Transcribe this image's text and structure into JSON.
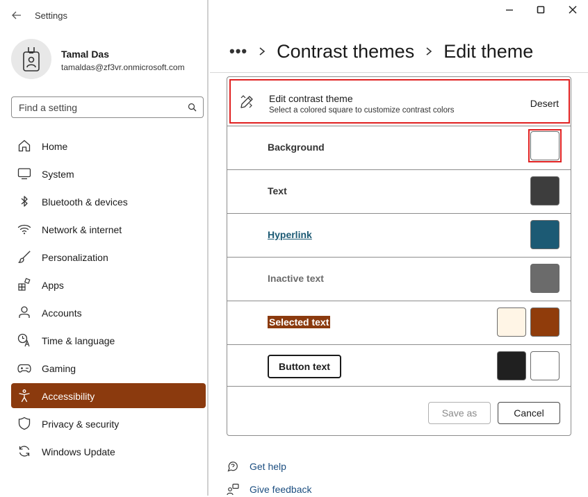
{
  "app": {
    "title": "Settings"
  },
  "user": {
    "name": "Tamal Das",
    "email": "tamaldas@zf3vr.onmicrosoft.com"
  },
  "search": {
    "placeholder": "Find a setting",
    "icon": "search-icon"
  },
  "nav": [
    {
      "id": "home",
      "label": "Home",
      "icon": "home-icon"
    },
    {
      "id": "system",
      "label": "System",
      "icon": "monitor-icon"
    },
    {
      "id": "bluetooth",
      "label": "Bluetooth & devices",
      "icon": "bluetooth-icon"
    },
    {
      "id": "network",
      "label": "Network & internet",
      "icon": "wifi-icon"
    },
    {
      "id": "personalization",
      "label": "Personalization",
      "icon": "brush-icon"
    },
    {
      "id": "apps",
      "label": "Apps",
      "icon": "apps-icon"
    },
    {
      "id": "accounts",
      "label": "Accounts",
      "icon": "person-icon"
    },
    {
      "id": "time",
      "label": "Time & language",
      "icon": "clock-language-icon"
    },
    {
      "id": "gaming",
      "label": "Gaming",
      "icon": "gamepad-icon"
    },
    {
      "id": "accessibility",
      "label": "Accessibility",
      "icon": "accessibility-icon",
      "active": true
    },
    {
      "id": "privacy",
      "label": "Privacy & security",
      "icon": "shield-icon"
    },
    {
      "id": "update",
      "label": "Windows Update",
      "icon": "update-icon"
    }
  ],
  "breadcrumb": {
    "more": "•••",
    "parent": "Contrast themes",
    "current": "Edit theme"
  },
  "edit_header": {
    "title": "Edit contrast theme",
    "subtitle": "Select a colored square to customize contrast colors",
    "theme_name": "Desert"
  },
  "color_rows": {
    "background": {
      "label": "Background"
    },
    "text": {
      "label": "Text"
    },
    "hyperlink": {
      "label": "Hyperlink"
    },
    "inactive": {
      "label": "Inactive text"
    },
    "selected": {
      "label": "Selected text"
    },
    "button": {
      "label": "Button text"
    }
  },
  "colors": {
    "background": "#ffffff",
    "text": "#3d3d3d",
    "hyperlink": "#1c5a74",
    "inactive": "#6b6b6b",
    "selected_bg": "#fff5e6",
    "selected_fg": "#903c0b",
    "button_bg": "#202020",
    "button_fg": "#ffffff",
    "accent": "#8b3a0e",
    "highlight_border": "#e02020"
  },
  "actions": {
    "save_as": "Save as",
    "cancel": "Cancel"
  },
  "links": {
    "get_help": "Get help",
    "give_feedback": "Give feedback"
  }
}
